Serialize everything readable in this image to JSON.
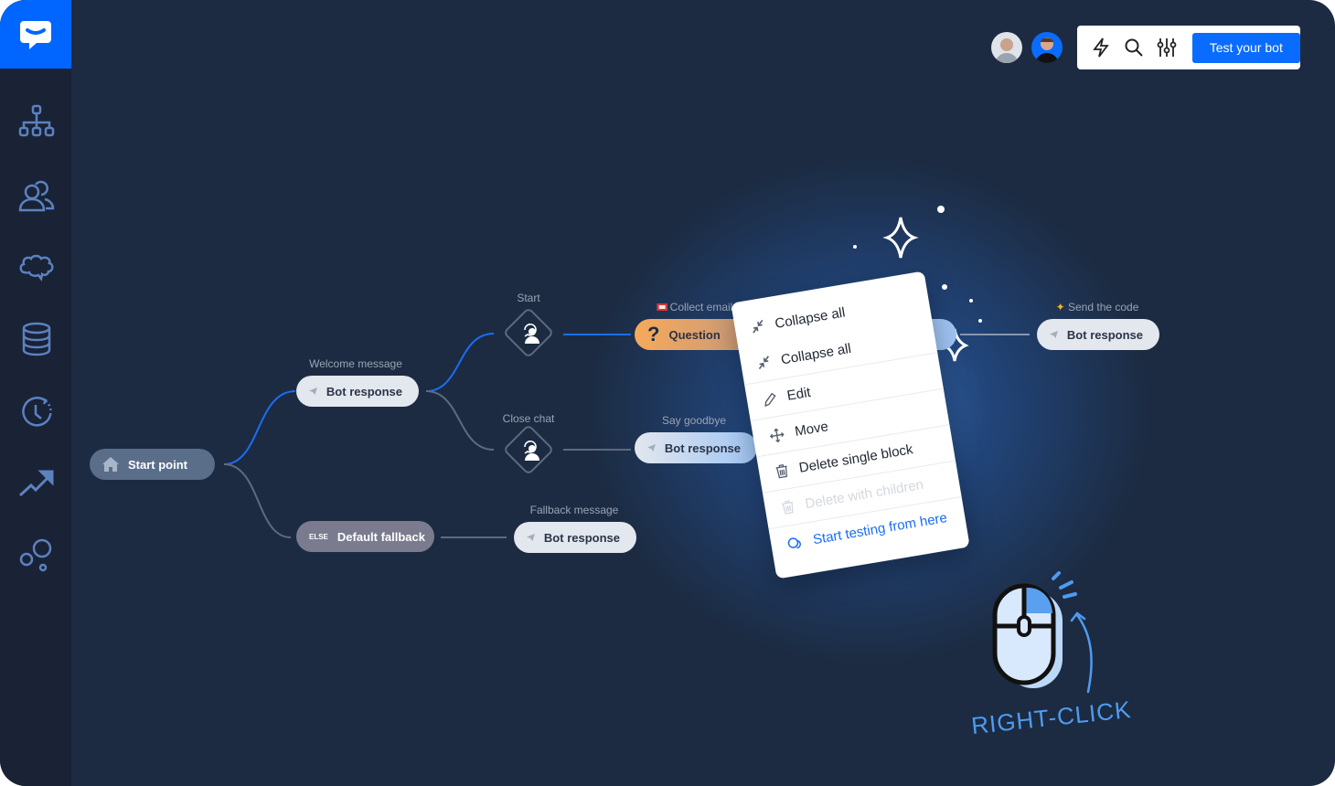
{
  "colors": {
    "accent": "#0a6cff",
    "sidebar": "#1a2236",
    "canvas": "#1c2b42",
    "question": "#f6a95a"
  },
  "sidebar": {
    "items": [
      {
        "icon": "logo-chat-icon"
      },
      {
        "icon": "flow-tree-icon"
      },
      {
        "icon": "users-icon"
      },
      {
        "icon": "brain-icon"
      },
      {
        "icon": "database-icon"
      },
      {
        "icon": "history-icon"
      },
      {
        "icon": "trend-up-icon"
      },
      {
        "icon": "bubbles-icon"
      }
    ]
  },
  "toolbar": {
    "test_label": "Test your bot",
    "icons": [
      "lightning-icon",
      "search-icon",
      "sliders-icon"
    ]
  },
  "flow": {
    "start_point": "Start point",
    "welcome_label": "Welcome message",
    "welcome_node": "Bot response",
    "fallback_node": "Default fallback",
    "else_badge": "ELSE",
    "fallback_label": "Fallback message",
    "fallback_response": "Bot response",
    "start_label": "Start",
    "close_label": "Close chat",
    "collect_label": "Collect email",
    "question_node": "Question",
    "goodbye_label": "Say goodbye",
    "goodbye_node": "Bot response",
    "send_label": "Send the code",
    "send_node": "Bot response"
  },
  "context_menu": {
    "items": [
      {
        "label": "Collapse all",
        "icon": "collapse-icon"
      },
      {
        "label": "Collapse all",
        "icon": "collapse-icon"
      },
      {
        "label": "Edit",
        "icon": "pencil-icon"
      },
      {
        "label": "Move",
        "icon": "move-icon"
      },
      {
        "label": "Delete single block",
        "icon": "trash-icon"
      },
      {
        "label": "Delete with children",
        "icon": "trash-icon",
        "disabled": true
      },
      {
        "label": "Start testing from here",
        "icon": "chat-bubbles-icon"
      }
    ]
  },
  "annotation": "RIGHT-CLICK"
}
